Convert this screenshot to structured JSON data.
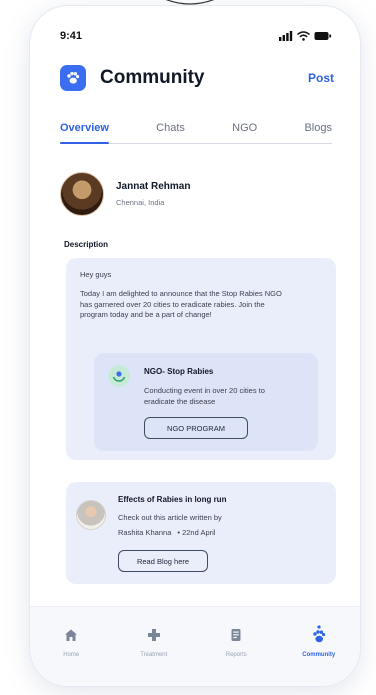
{
  "status_bar": {
    "time": "9:41"
  },
  "header": {
    "title": "Community",
    "post_label": "Post"
  },
  "tabs": [
    {
      "label": "Overview",
      "active": true
    },
    {
      "label": "Chats",
      "active": false
    },
    {
      "label": "NGO",
      "active": false
    },
    {
      "label": "Blogs",
      "active": false
    }
  ],
  "profile": {
    "name": "Jannat Rehman",
    "location": "Chennai, India"
  },
  "description_label": "Description",
  "post": {
    "greeting": "Hey guys",
    "body": "Today I am delighted to announce that the Stop Rabies NGO has garnered over 20 cities to eradicate rabies. Join the program today and be a part of change!",
    "ngo": {
      "title": "NGO- Stop Rabies",
      "description": "Conducting event in over 20 cities to eradicate the disease",
      "button_label": "NGO PROGRAM"
    }
  },
  "blog": {
    "title": "Effects of Rabies in long run",
    "subtitle": "Check out this article written by",
    "author": "Rashita Khanna",
    "date": "• 22nd April",
    "button_label": "Read Blog here"
  },
  "nav": [
    {
      "label": "Home",
      "icon": "home-icon",
      "active": false
    },
    {
      "label": "Treatment",
      "icon": "cross-icon",
      "active": false
    },
    {
      "label": "Reports",
      "icon": "report-icon",
      "active": false
    },
    {
      "label": "Community",
      "icon": "community-icon",
      "active": true
    }
  ],
  "colors": {
    "accent": "#2f63e6",
    "card_bg": "#eaeefb",
    "ngo_card_bg": "#dde4f8",
    "nav_inactive": "#9aa3b2"
  }
}
